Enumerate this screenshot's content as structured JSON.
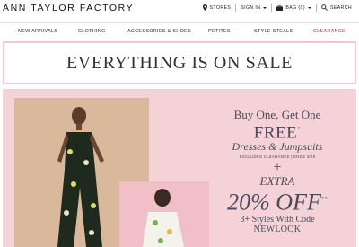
{
  "brand": {
    "logo": "ANN TAYLOR FACTORY"
  },
  "utility_nav": {
    "stores": "STORES",
    "sign_in": "SIGN IN",
    "bag": "BAG (0)",
    "search": "SEARCH"
  },
  "main_nav": {
    "items": [
      {
        "label": "NEW ARRIVALS"
      },
      {
        "label": "CLOTHING"
      },
      {
        "label": "ACCESSORIES & SHOES"
      },
      {
        "label": "PETITES"
      },
      {
        "label": "STYLE STEALS"
      },
      {
        "label": "CLEARANCE"
      }
    ],
    "highlight_color": "#c2185b"
  },
  "sale_banner": {
    "text": "EVERYTHING IS ON SALE",
    "border_color": "#f2c9d3"
  },
  "promo": {
    "background": "#f4d2d7",
    "line1": "Buy One, Get One",
    "line2": "FREE",
    "line2_mark": "*",
    "line3": "Dresses & Jumpsuits",
    "fine_print": "EXCLUDES CLEARANCE | ENDS 3/28",
    "plus": "+",
    "extra": "EXTRA",
    "discount": "20% OFF",
    "discount_mark": "**",
    "styles": "3+ Styles With Code",
    "code": "NEWLOOK"
  }
}
